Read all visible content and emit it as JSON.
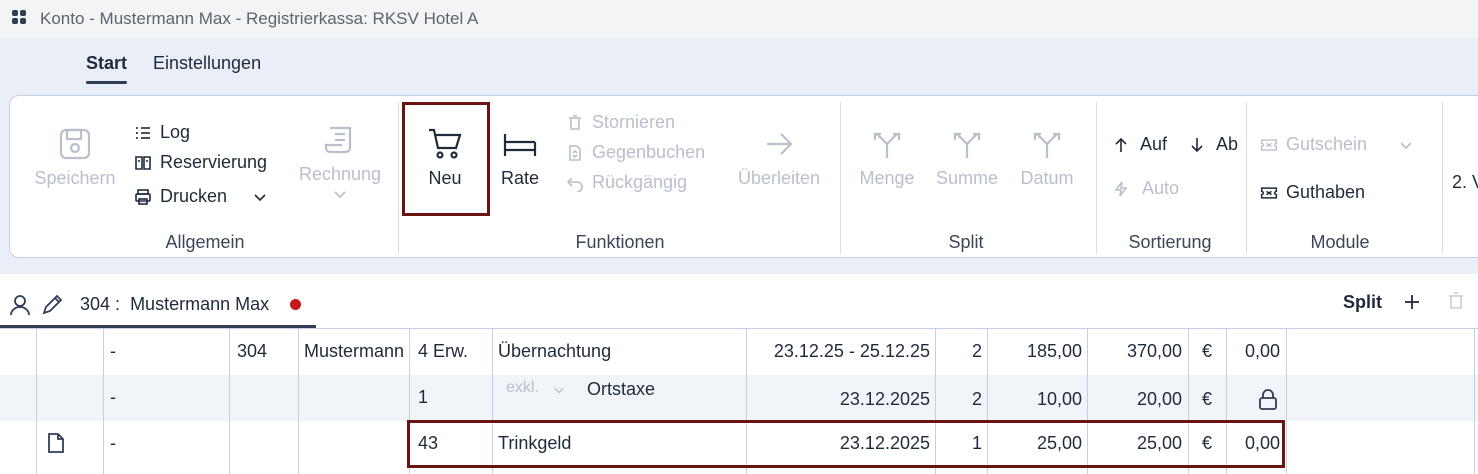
{
  "window": {
    "title": "Konto - Mustermann Max - Registrierkassa: RKSV Hotel A"
  },
  "menu_tabs": [
    {
      "label": "Start"
    },
    {
      "label": "Einstellungen"
    }
  ],
  "ribbon": {
    "allgemein": {
      "label": "Allgemein",
      "speichern": "Speichern",
      "log": "Log",
      "reservierung": "Reservierung",
      "drucken": "Drucken",
      "rechnung": "Rechnung"
    },
    "funktionen": {
      "label": "Funktionen",
      "neu": "Neu",
      "rate": "Rate",
      "stornieren": "Stornieren",
      "gegenbuchen": "Gegenbuchen",
      "rueckgaengig": "Rückgängig",
      "ueberleiten": "Überleiten"
    },
    "split": {
      "label": "Split",
      "menge": "Menge",
      "summe": "Summe",
      "datum": "Datum"
    },
    "sortierung": {
      "label": "Sortierung",
      "auf": "Auf",
      "ab": "Ab",
      "auto": "Auto"
    },
    "module": {
      "label": "Module",
      "gutschein": "Gutschein",
      "guthaben": "Guthaben"
    },
    "overflow": "2. V"
  },
  "guest": {
    "room_label": "304 :",
    "name": "Mustermann Max",
    "split_label": "Split"
  },
  "rows": [
    {
      "c2": "-",
      "room": "304",
      "guest": "Mustermann",
      "qty": "4 Erw.",
      "desc": "Übernachtung",
      "date": "23.12.25 - 25.12.25",
      "count": "2",
      "price": "185,00",
      "total": "370,00",
      "cur": "€",
      "extra": "0,00"
    },
    {
      "c2": "-",
      "room": "",
      "guest": "",
      "qty": "1",
      "tax_mode": "exkl.",
      "desc": "Ortstaxe",
      "date": "23.12.2025",
      "count": "2",
      "price": "10,00",
      "total": "20,00",
      "cur": "€"
    },
    {
      "c2": "-",
      "room": "",
      "guest": "",
      "qty": "43",
      "desc": "Trinkgeld",
      "date": "23.12.2025",
      "count": "1",
      "price": "25,00",
      "total": "25,00",
      "cur": "€",
      "extra": "0,00"
    }
  ]
}
